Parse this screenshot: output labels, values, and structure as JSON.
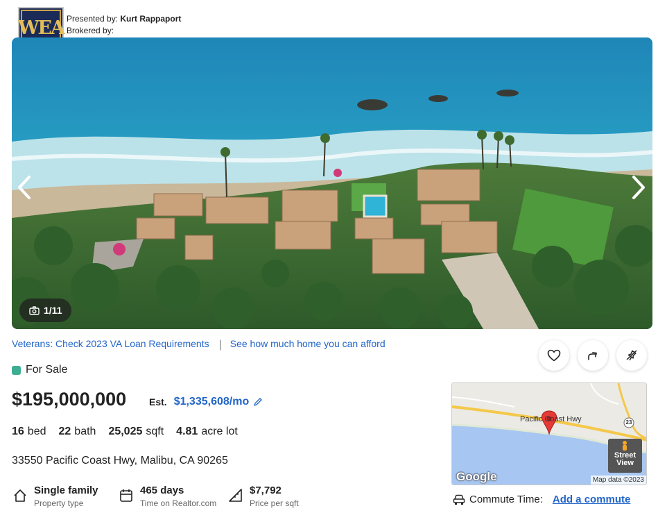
{
  "header": {
    "logo_text": "WEA",
    "presented_label": "Presented by:",
    "agent_name": "Kurt Rappaport",
    "brokered_label": "Brokered by:"
  },
  "gallery": {
    "counter": "1/11",
    "photo_description_icon": "camera-icon"
  },
  "links": {
    "va_loan": "Veterans: Check 2023 VA Loan Requirements",
    "afford": "See how much home you can afford"
  },
  "actions": [
    "heart-icon",
    "share-icon",
    "hide-icon"
  ],
  "listing": {
    "status": "For Sale",
    "status_color": "#3dae91",
    "price": "$195,000,000",
    "est_label": "Est.",
    "est_value": "$1,335,608/mo",
    "beds_num": "16",
    "beds_label": "bed",
    "baths_num": "22",
    "baths_label": "bath",
    "sqft_num": "25,025",
    "sqft_label": "sqft",
    "lot_num": "4.81",
    "lot_label": "acre lot",
    "address": "33550 Pacific Coast Hwy, Malibu, CA 90265"
  },
  "features": [
    {
      "value": "Single family",
      "label": "Property type",
      "icon": "house-icon"
    },
    {
      "value": "465 days",
      "label": "Time on Realtor.com",
      "icon": "calendar-icon"
    },
    {
      "value": "$7,792",
      "label": "Price per sqft",
      "icon": "ruler-icon"
    }
  ],
  "map": {
    "road_label": "Pacific Coast Hwy",
    "route_shield": "23",
    "street_view_label_1": "Street",
    "street_view_label_2": "View",
    "google": "Google",
    "map_data": "Map data ©2023"
  },
  "commute": {
    "label": "Commute Time:",
    "link": "Add a commute"
  },
  "colors": {
    "link": "#2265c7",
    "text": "#222222"
  }
}
